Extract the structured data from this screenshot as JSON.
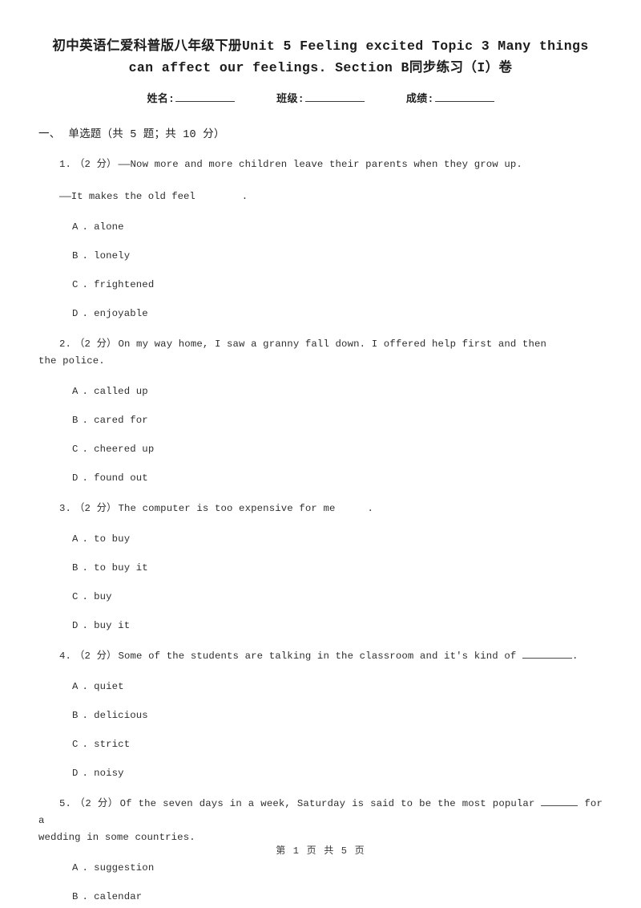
{
  "document": {
    "title": "初中英语仁爱科普版八年级下册Unit 5 Feeling excited Topic 3 Many things can affect our feelings. Section B同步练习（I）卷",
    "info_fields": [
      {
        "label": "姓名:"
      },
      {
        "label": "班级:"
      },
      {
        "label": "成绩:"
      }
    ],
    "section": {
      "number": "一、",
      "title": "单选题（共 5 题；共 10 分）"
    },
    "questions": [
      {
        "number": "1.",
        "score": "（2 分）",
        "stem": "——Now more and more children leave their parents when they grow up.",
        "stem_line2": "——It makes the old feel",
        "stem_line2_tail": ".",
        "options": [
          {
            "letter": "A",
            "dot": ".",
            "text": "alone"
          },
          {
            "letter": "B",
            "dot": ".",
            "text": "lonely"
          },
          {
            "letter": "C",
            "dot": ".",
            "text": "frightened"
          },
          {
            "letter": "D",
            "dot": ".",
            "text": "enjoyable"
          }
        ]
      },
      {
        "number": "2.",
        "score": "（2 分）",
        "stem": "On my way home, I saw a granny fall down. I offered help first and then",
        "stem_tail": "the police.",
        "options": [
          {
            "letter": "A",
            "dot": ".",
            "text": "called up"
          },
          {
            "letter": "B",
            "dot": ".",
            "text": "cared for"
          },
          {
            "letter": "C",
            "dot": ".",
            "text": "cheered up"
          },
          {
            "letter": "D",
            "dot": ".",
            "text": "found out"
          }
        ]
      },
      {
        "number": "3.",
        "score": "（2 分）",
        "stem": "The computer is too expensive for me",
        "stem_tail": ".",
        "options": [
          {
            "letter": "A",
            "dot": ".",
            "text": "to buy"
          },
          {
            "letter": "B",
            "dot": ".",
            "text": "to buy it"
          },
          {
            "letter": "C",
            "dot": ".",
            "text": "buy"
          },
          {
            "letter": "D",
            "dot": ".",
            "text": "buy it"
          }
        ]
      },
      {
        "number": "4.",
        "score": "（2 分）",
        "stem": "Some of the students are talking in the classroom and it's kind of",
        "stem_tail": ".",
        "options": [
          {
            "letter": "A",
            "dot": ".",
            "text": "quiet"
          },
          {
            "letter": "B",
            "dot": ".",
            "text": "delicious"
          },
          {
            "letter": "C",
            "dot": ".",
            "text": "strict"
          },
          {
            "letter": "D",
            "dot": ".",
            "text": "noisy"
          }
        ]
      },
      {
        "number": "5.",
        "score": "（2 分）",
        "stem": "Of the seven days in a week, Saturday is said to be the most popular",
        "stem_mid": "for a",
        "stem_tail": "wedding in some countries.",
        "options": [
          {
            "letter": "A",
            "dot": ".",
            "text": "suggestion"
          },
          {
            "letter": "B",
            "dot": ".",
            "text": "calendar"
          }
        ]
      }
    ],
    "footer": "第 1 页 共 5 页"
  }
}
